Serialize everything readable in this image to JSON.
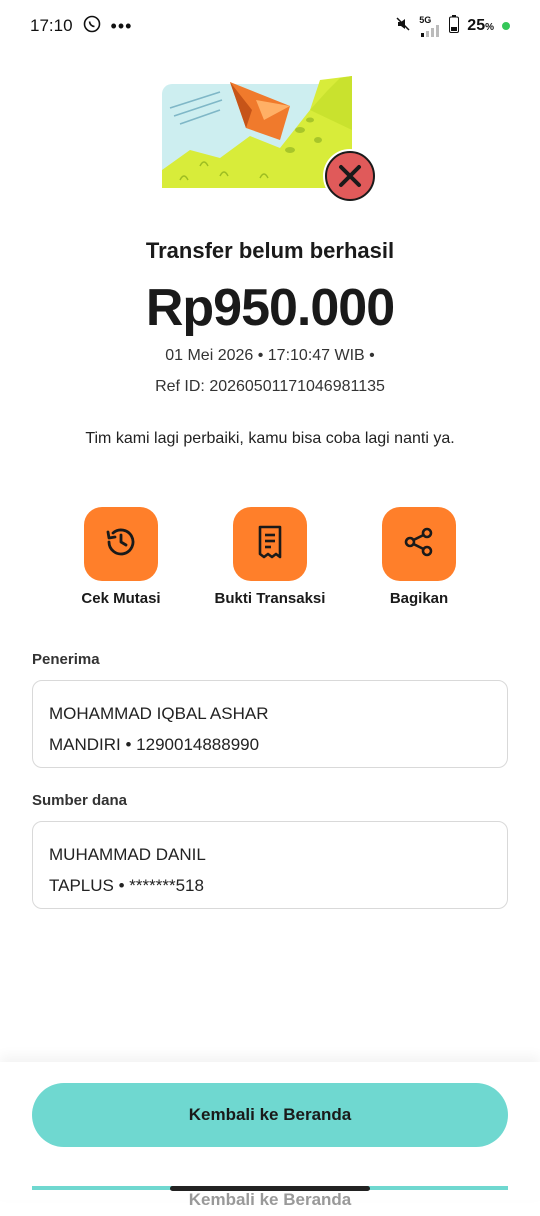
{
  "status_bar": {
    "time": "17:10",
    "battery": "25",
    "battery_unit": "%",
    "network": "5G"
  },
  "transfer": {
    "title": "Transfer belum berhasil",
    "amount": "Rp950.000",
    "datetime": "01 Mei 2026 • 17:10:47 WIB •",
    "ref": "Ref ID: 20260501171046981135",
    "message": "Tim kami lagi perbaiki, kamu bisa coba lagi nanti ya."
  },
  "actions": [
    {
      "label": "Cek Mutasi",
      "icon": "history-icon"
    },
    {
      "label": "Bukti Transaksi",
      "icon": "receipt-icon"
    },
    {
      "label": "Bagikan",
      "icon": "share-icon"
    }
  ],
  "recipient": {
    "label": "Penerima",
    "name": "MOHAMMAD IQBAL ASHAR",
    "account": "MANDIRI • 1290014888990"
  },
  "source": {
    "label": "Sumber dana",
    "name": "MUHAMMAD DANIL",
    "account": "TAPLUS • *******518"
  },
  "footer": {
    "primary_label": "Kembali ke Beranda"
  },
  "colors": {
    "accent_orange": "#ff7f2a",
    "button_teal": "#6fd8d0",
    "error_red": "#e05a5a"
  }
}
